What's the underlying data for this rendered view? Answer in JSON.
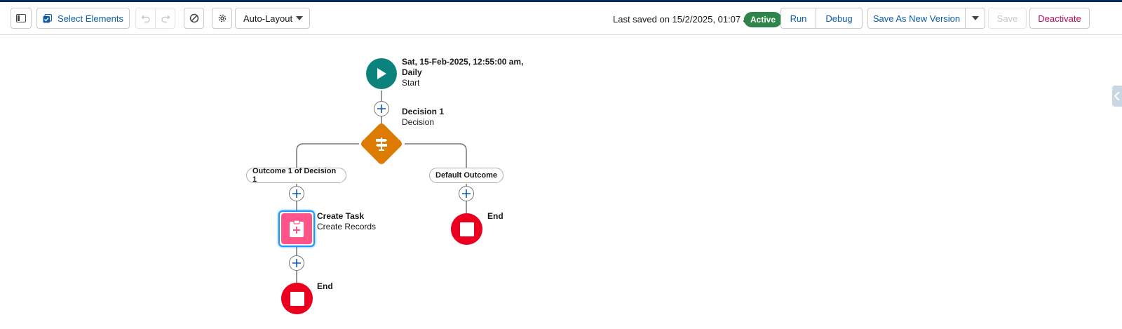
{
  "toolbar": {
    "select_elements_label": "Select Elements",
    "layout_select_value": "Auto-Layout",
    "last_saved_text": "Last saved on 15/2/2025, 01:07 am",
    "status_badge": "Active",
    "run_label": "Run",
    "debug_label": "Debug",
    "save_as_new_version_label": "Save As New Version",
    "save_label": "Save",
    "deactivate_label": "Deactivate"
  },
  "flow": {
    "start": {
      "title_line1": "Sat, 15-Feb-2025, 12:55:00 am,",
      "title_line2": "Daily",
      "type": "Start"
    },
    "decision": {
      "title": "Decision 1",
      "type": "Decision"
    },
    "outcomes": {
      "left": "Outcome 1 of Decision 1",
      "right": "Default Outcome"
    },
    "create_task": {
      "title": "Create Task",
      "type": "Create Records"
    },
    "end_left": "End",
    "end_right": "End"
  },
  "colors": {
    "start": "#0b827c",
    "decision": "#dd7a01",
    "create_records": "#ff538a",
    "end": "#ea001e",
    "active_badge": "#2e844a",
    "link_blue": "#0b5cab",
    "deactivate": "#b60554"
  },
  "icons": [
    "panel-toggle-icon",
    "select-elements-icon",
    "undo-icon",
    "redo-icon",
    "cancel-icon",
    "settings-gear-icon",
    "chevron-down-icon",
    "play-icon",
    "signpost-icon",
    "clipboard-add-icon",
    "stop-icon",
    "add-icon"
  ]
}
